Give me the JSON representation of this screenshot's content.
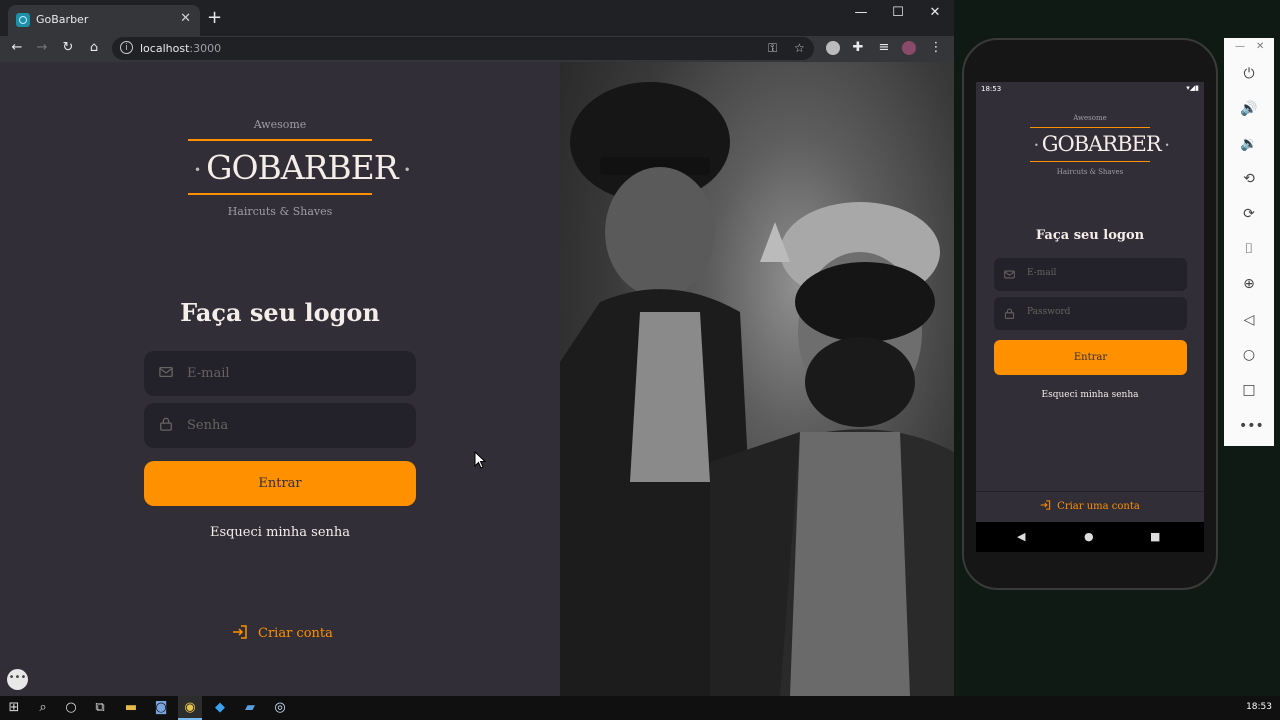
{
  "browser": {
    "tab_title": "GoBarber",
    "url_host": "localhost",
    "url_port": ":3000"
  },
  "page": {
    "logo": {
      "top": "Awesome",
      "main": "GOBARBER",
      "sub": "Haircuts & Shaves"
    },
    "title": "Faça seu logon",
    "email_placeholder": "E-mail",
    "password_placeholder": "Senha",
    "submit_label": "Entrar",
    "forgot_label": "Esqueci minha senha",
    "create_label": "Criar conta"
  },
  "phone": {
    "status_time": "18:53",
    "logo": {
      "top": "Awesome",
      "main": "GOBARBER",
      "sub": "Haircuts & Shaves"
    },
    "title": "Faça seu logon",
    "email_placeholder": "E-mail",
    "password_placeholder": "Password",
    "submit_label": "Entrar",
    "forgot_label": "Esqueci minha senha",
    "create_label": "Criar uma conta"
  },
  "taskbar": {
    "time": "18:53"
  },
  "colors": {
    "accent": "#ff9000",
    "background": "#312e38",
    "input": "#232129",
    "text": "#f4ede8"
  }
}
